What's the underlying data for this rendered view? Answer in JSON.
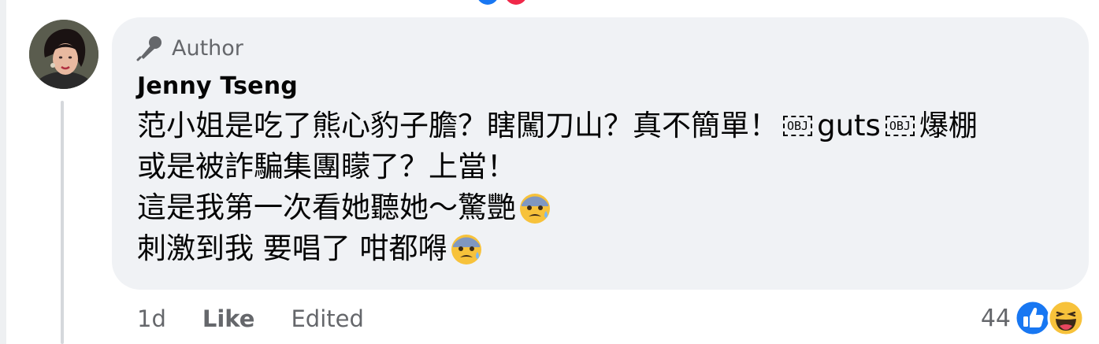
{
  "comment": {
    "badge_label": "Author",
    "author_name": "Jenny Tseng",
    "lines": [
      {
        "a": "范小姐是吃了熊心豹子膽？瞎闖刀山？真不簡單！",
        "obj1": "OBJ",
        "b": "guts",
        "obj2": "OBJ",
        "c": "爆棚"
      },
      {
        "text": "或是被詐騙集團矇了？上當！"
      },
      {
        "text": "這是我第一次看她聽她～驚艷"
      },
      {
        "text": "刺激到我 要唱了 咁都嘚"
      }
    ]
  },
  "actions": {
    "time": "1d",
    "like_label": "Like",
    "edited_label": "Edited"
  },
  "reactions": {
    "count": "44",
    "icons": [
      "like-icon",
      "haha-icon"
    ]
  },
  "icons": {
    "badge": "microphone-icon",
    "emoji": "anxious-sweat-face-icon"
  },
  "colors": {
    "bubble": "#f0f2f5",
    "secondary_text": "#65676b",
    "like_blue": "#1877f2"
  }
}
